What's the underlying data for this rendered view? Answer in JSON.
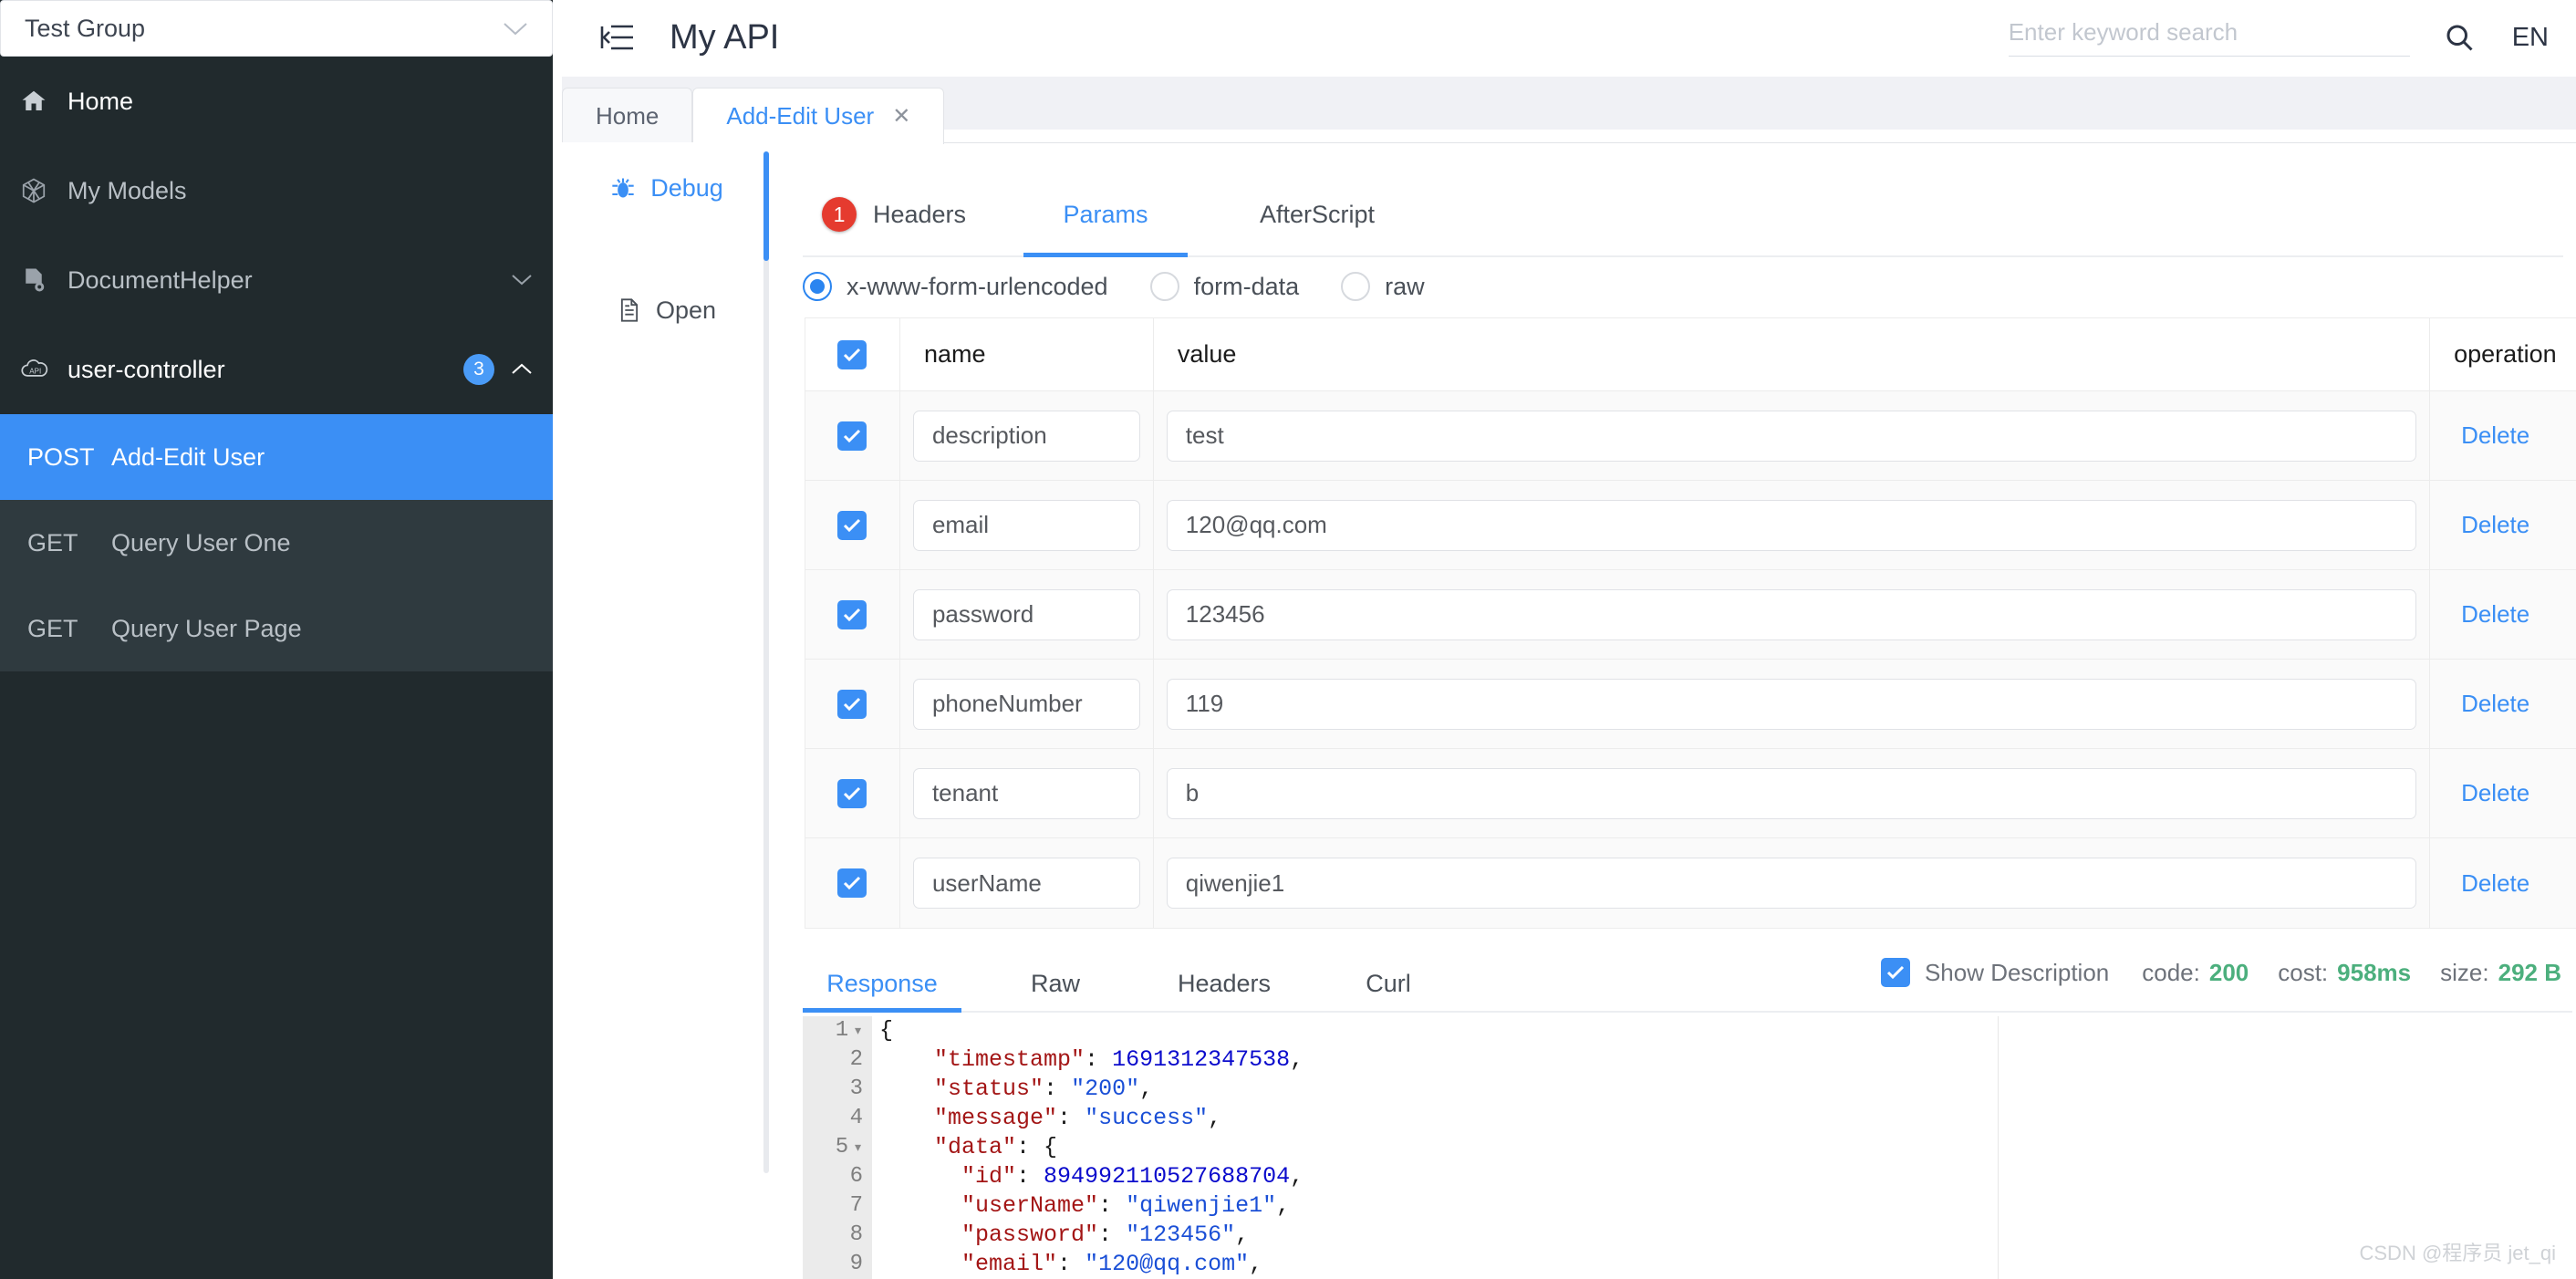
{
  "sidebar": {
    "group_select": {
      "value": "Test Group",
      "icon": "chevron-down-icon"
    },
    "items": [
      {
        "label": "Home",
        "icon": "home-icon"
      },
      {
        "label": "My Models",
        "icon": "cube-icon"
      },
      {
        "label": "DocumentHelper",
        "icon": "document-gear-icon",
        "chevron": "chevron-down-icon"
      },
      {
        "label": "user-controller",
        "icon": "api-cloud-icon",
        "badge": "3",
        "chevron": "chevron-up-icon"
      }
    ],
    "api_list": [
      {
        "method": "POST",
        "title": "Add-Edit User",
        "active": true
      },
      {
        "method": "GET",
        "title": "Query User One",
        "active": false
      },
      {
        "method": "GET",
        "title": "Query User Page",
        "active": false
      }
    ]
  },
  "topbar": {
    "collapse_icon": "collapse-sidebar-icon",
    "title": "My API",
    "search": {
      "value": "",
      "placeholder": "Enter keyword search"
    },
    "search_icon": "search-icon",
    "language": "EN"
  },
  "tabs": [
    {
      "label": "Home",
      "active": false,
      "closable": false
    },
    {
      "label": "Add-Edit User",
      "active": true,
      "closable": true,
      "close": "✕"
    }
  ],
  "rail": [
    {
      "label": "Debug",
      "icon": "bug-icon",
      "active": true
    },
    {
      "label": "Open",
      "icon": "file-icon",
      "active": false
    }
  ],
  "request": {
    "tabs": [
      {
        "label": "Headers",
        "badge": "1",
        "active": false
      },
      {
        "label": "Params",
        "badge": "",
        "active": true
      },
      {
        "label": "AfterScript",
        "badge": "",
        "active": false
      }
    ],
    "body_types": [
      {
        "label": "x-www-form-urlencoded",
        "selected": true
      },
      {
        "label": "form-data",
        "selected": false
      },
      {
        "label": "raw",
        "selected": false
      }
    ],
    "table": {
      "columns": [
        "",
        "name",
        "value",
        "operation"
      ],
      "header_checked": true,
      "rows": [
        {
          "checked": true,
          "name": "description",
          "value": "test",
          "operation": "Delete"
        },
        {
          "checked": true,
          "name": "email",
          "value": "120@qq.com",
          "operation": "Delete"
        },
        {
          "checked": true,
          "name": "password",
          "value": "123456",
          "operation": "Delete"
        },
        {
          "checked": true,
          "name": "phoneNumber",
          "value": "119",
          "operation": "Delete"
        },
        {
          "checked": true,
          "name": "tenant",
          "value": "b",
          "operation": "Delete"
        },
        {
          "checked": true,
          "name": "userName",
          "value": "qiwenjie1",
          "operation": "Delete"
        }
      ]
    }
  },
  "response": {
    "tabs": [
      {
        "label": "Response",
        "active": true
      },
      {
        "label": "Raw",
        "active": false
      },
      {
        "label": "Headers",
        "active": false
      },
      {
        "label": "Curl",
        "active": false
      }
    ],
    "show_description": {
      "label": "Show Description",
      "checked": true
    },
    "meta": {
      "code_label": "code:",
      "code_value": "200",
      "cost_label": "cost:",
      "cost_value": "958ms",
      "size_label": "size:",
      "size_value": "292 B"
    },
    "code_lines": [
      {
        "n": "1",
        "fold": true,
        "segments": [
          {
            "t": "{",
            "c": "p"
          }
        ]
      },
      {
        "n": "2",
        "fold": false,
        "segments": [
          {
            "t": "    ",
            "c": "p"
          },
          {
            "t": "\"timestamp\"",
            "c": "k"
          },
          {
            "t": ": ",
            "c": "p"
          },
          {
            "t": "1691312347538",
            "c": "n"
          },
          {
            "t": ",",
            "c": "p"
          }
        ]
      },
      {
        "n": "3",
        "fold": false,
        "segments": [
          {
            "t": "    ",
            "c": "p"
          },
          {
            "t": "\"status\"",
            "c": "k"
          },
          {
            "t": ": ",
            "c": "p"
          },
          {
            "t": "\"200\"",
            "c": "s"
          },
          {
            "t": ",",
            "c": "p"
          }
        ]
      },
      {
        "n": "4",
        "fold": false,
        "segments": [
          {
            "t": "    ",
            "c": "p"
          },
          {
            "t": "\"message\"",
            "c": "k"
          },
          {
            "t": ": ",
            "c": "p"
          },
          {
            "t": "\"success\"",
            "c": "s"
          },
          {
            "t": ",",
            "c": "p"
          }
        ]
      },
      {
        "n": "5",
        "fold": true,
        "segments": [
          {
            "t": "    ",
            "c": "p"
          },
          {
            "t": "\"data\"",
            "c": "k"
          },
          {
            "t": ": {",
            "c": "p"
          }
        ]
      },
      {
        "n": "6",
        "fold": false,
        "segments": [
          {
            "t": "      ",
            "c": "p"
          },
          {
            "t": "\"id\"",
            "c": "k"
          },
          {
            "t": ": ",
            "c": "p"
          },
          {
            "t": "894992110527688704",
            "c": "n"
          },
          {
            "t": ",",
            "c": "p"
          }
        ]
      },
      {
        "n": "7",
        "fold": false,
        "segments": [
          {
            "t": "      ",
            "c": "p"
          },
          {
            "t": "\"userName\"",
            "c": "k"
          },
          {
            "t": ": ",
            "c": "p"
          },
          {
            "t": "\"qiwenjie1\"",
            "c": "s"
          },
          {
            "t": ",",
            "c": "p"
          }
        ]
      },
      {
        "n": "8",
        "fold": false,
        "segments": [
          {
            "t": "      ",
            "c": "p"
          },
          {
            "t": "\"password\"",
            "c": "k"
          },
          {
            "t": ": ",
            "c": "p"
          },
          {
            "t": "\"123456\"",
            "c": "s"
          },
          {
            "t": ",",
            "c": "p"
          }
        ]
      },
      {
        "n": "9",
        "fold": false,
        "segments": [
          {
            "t": "      ",
            "c": "p"
          },
          {
            "t": "\"email\"",
            "c": "k"
          },
          {
            "t": ": ",
            "c": "p"
          },
          {
            "t": "\"120@qq.com\"",
            "c": "s"
          },
          {
            "t": ",",
            "c": "p"
          }
        ]
      }
    ]
  },
  "watermark": "CSDN @程序员 jet_qi",
  "colors": {
    "accent": "#3b8ff5",
    "sidebar_bg": "#212a2d",
    "sublist_bg": "#2f3a3f",
    "badge_red": "#e53b2f",
    "status_green": "#4caf7d"
  }
}
